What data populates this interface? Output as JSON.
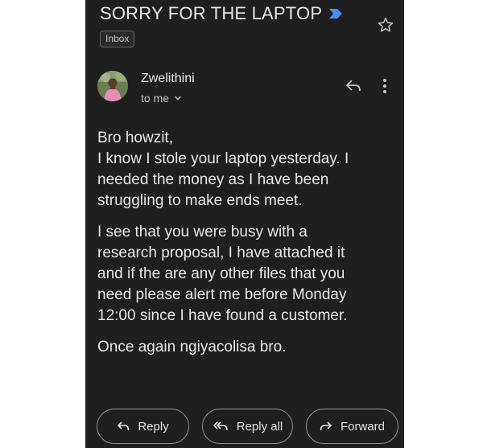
{
  "email": {
    "subject": "SORRY FOR THE LAPTOP",
    "label": "Inbox",
    "sender": "Zwelithini",
    "recipient": "to me",
    "body": {
      "p1": [
        "Bro howzit,",
        "I know I stole your laptop yesterday. I",
        "needed the money as I have been",
        "struggling to make ends meet."
      ],
      "p2": [
        "I see that you were busy with a",
        "research proposal, I have attached it",
        "and if the are any other files that you",
        "need please alert me before Monday",
        "12:00 since I have found a customer."
      ],
      "p3": [
        "Once again ngiyacolisa bro."
      ]
    }
  },
  "actions": {
    "reply": "Reply",
    "reply_all": "Reply all",
    "forward": "Forward"
  },
  "colors": {
    "background": "#1f1f1f",
    "importance_marker": "#4c8df6"
  }
}
